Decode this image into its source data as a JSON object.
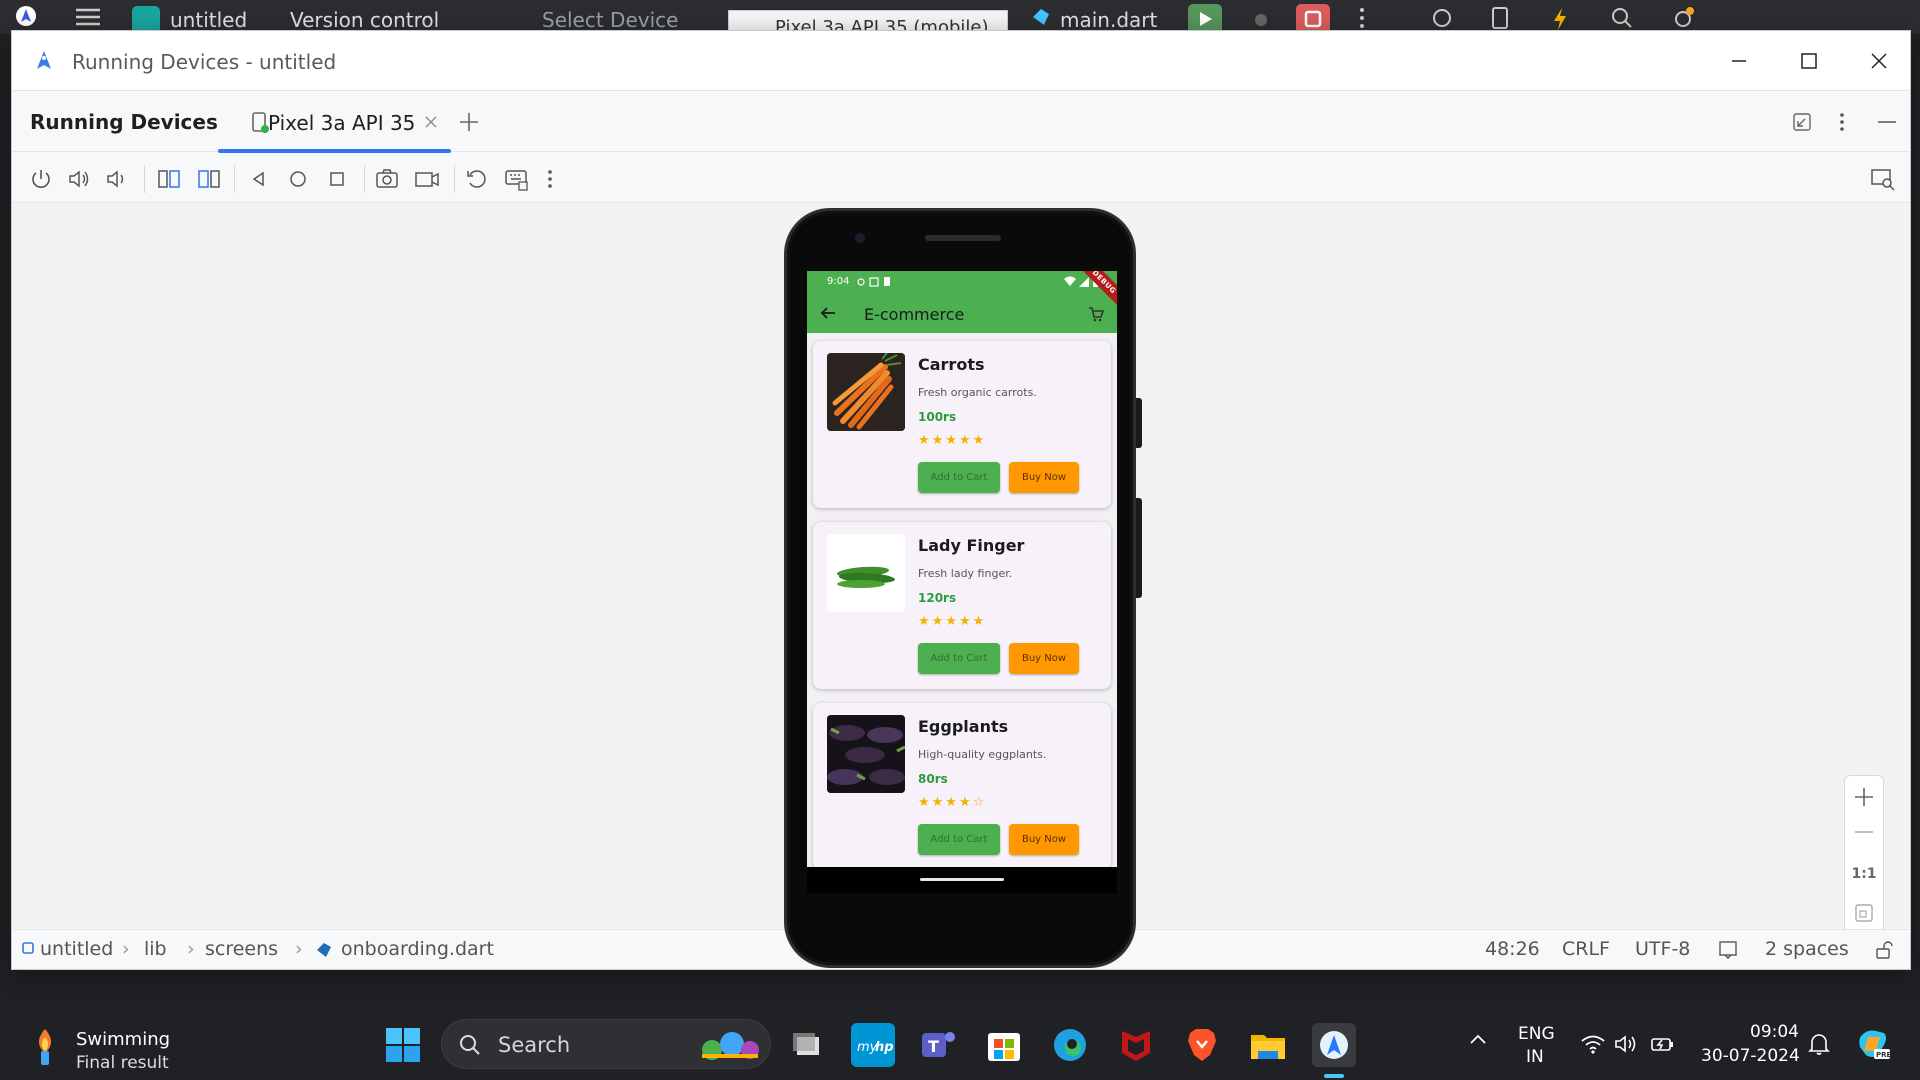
{
  "ide_toolbar": {
    "project": "untitled",
    "vcs": "Version control",
    "device_select": "Select Device",
    "device_tab": "Pixel 3a API 35 (mobile)",
    "run_config": "main.dart"
  },
  "window": {
    "title": "Running Devices - untitled"
  },
  "tabs": {
    "panel_label": "Running Devices",
    "device_tab_label": "Pixel 3a API 35"
  },
  "statusbar": {
    "breadcrumb": [
      "untitled",
      "lib",
      "screens",
      "onboarding.dart"
    ],
    "position": "48:26",
    "line_sep": "CRLF",
    "encoding": "UTF-8",
    "indent": "2 spaces"
  },
  "zoom": {
    "one_to_one": "1:1"
  },
  "phone": {
    "status_time": "9:04",
    "app_title": "E-commerce",
    "debug_banner": "DEBUG",
    "colors": {
      "appbar": "#4caf50",
      "cart_button": "#4caf50",
      "buy_button": "#ff9800",
      "price": "#2e9b3a"
    },
    "products": [
      {
        "name": "Carrots",
        "desc": "Fresh organic carrots.",
        "price": "100rs",
        "stars": "★★★★★",
        "rating": 5,
        "add": "Add to Cart",
        "buy": "Buy Now"
      },
      {
        "name": "Lady Finger",
        "desc": "Fresh lady finger.",
        "price": "120rs",
        "stars": "★★★★★",
        "rating": 5,
        "add": "Add to Cart",
        "buy": "Buy Now"
      },
      {
        "name": "Eggplants",
        "desc": "High-quality eggplants.",
        "price": "80rs",
        "stars": "★★★★☆",
        "rating": 4,
        "add": "Add to Cart",
        "buy": "Buy Now"
      }
    ]
  },
  "taskbar": {
    "weather_title": "Swimming",
    "weather_sub": "Final result",
    "search": "Search",
    "lang_top": "ENG",
    "lang_bottom": "IN",
    "time": "09:04",
    "date": "30-07-2024"
  }
}
